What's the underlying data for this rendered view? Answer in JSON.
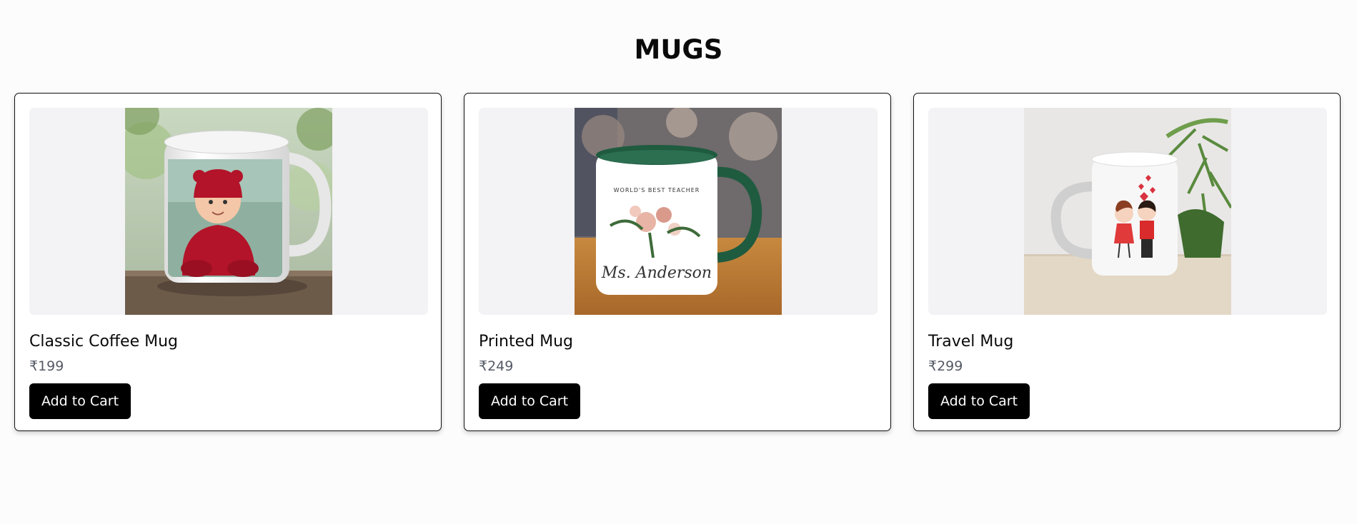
{
  "page": {
    "title": "MUGS"
  },
  "products": [
    {
      "name": "Classic Coffee Mug",
      "price": "₹199",
      "button_label": "Add to Cart",
      "image_icon": "mug-photo-baby-icon"
    },
    {
      "name": "Printed Mug",
      "price": "₹249",
      "button_label": "Add to Cart",
      "image_icon": "mug-photo-floral-icon",
      "mug_text_top": "WORLD'S BEST TEACHER",
      "mug_text_bottom": "Ms. Anderson"
    },
    {
      "name": "Travel Mug",
      "price": "₹299",
      "button_label": "Add to Cart",
      "image_icon": "mug-photo-couple-icon"
    }
  ],
  "colors": {
    "button_bg": "#000000",
    "button_text": "#ffffff",
    "price_text": "#555a66",
    "image_bg": "#f3f2f5"
  }
}
